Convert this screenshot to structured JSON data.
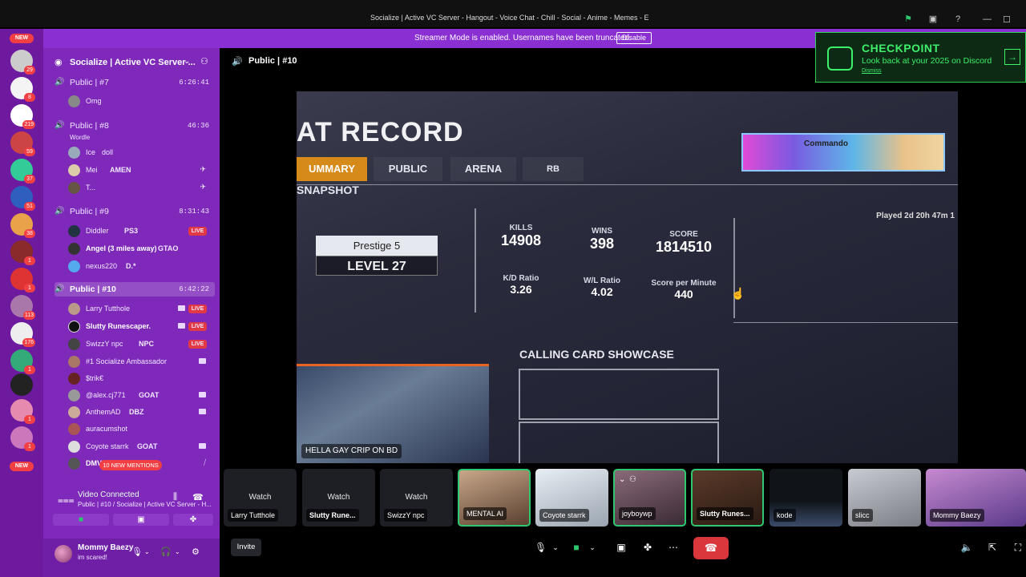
{
  "titlebar": {
    "title": "Socialize | Active VC Server - Hangout - Voice Chat - Chill - Social - Anime - Memes - E"
  },
  "banner": {
    "message": "Streamer Mode is enabled. Usernames have been truncated.",
    "disable_label": "Disable"
  },
  "rail": {
    "new_top": "NEW",
    "new_bottom": "NEW",
    "badges": [
      "29",
      "8",
      "219",
      "59",
      "37",
      "51",
      "38",
      "1",
      "1",
      "113",
      "176",
      "1",
      "1",
      "1"
    ]
  },
  "server": {
    "name": "Socialize | Active VC Server ..."
  },
  "channels": [
    {
      "name": "Public | #7",
      "time": "6:26:41"
    },
    {
      "name": "Public | #8",
      "time": "46:36",
      "activity": "Wordle"
    },
    {
      "name": "Public | #9",
      "time": "8:31:43"
    },
    {
      "name": "Public | #10",
      "time": "6:42:22"
    }
  ],
  "users": {
    "c7": [
      "Omg"
    ],
    "c8": [
      "Ice",
      "Mei",
      "T..."
    ],
    "c8_tags": [
      "doll",
      "AMEN"
    ],
    "c9": [
      "Diddler",
      "Angel (3 miles away)",
      "nexus220"
    ],
    "c9_tags": [
      "PS3",
      "GTAO",
      "D.*"
    ],
    "c10": [
      "Larry Tutthole",
      "Slutty Runescaper.",
      "SwizzY npc",
      "#1 Socialize Ambassador",
      "$trik€",
      "@alex.cj771",
      "AnthemAD",
      "auracumshot",
      "Coyote starrk",
      "DMV"
    ],
    "c10_tags": [
      "NPC",
      "GOAT",
      "DBZ",
      "GOAT"
    ]
  },
  "live_label": "LIVE",
  "mentions": "10 NEW MENTIONS",
  "voice": {
    "status": "Video Connected",
    "path": "Public | #10 / Socialize | Active VC Server - H..."
  },
  "me": {
    "name": "Mommy Baezy",
    "status": "im scared!"
  },
  "stage": {
    "title": "Public | #10",
    "caption": "HELLA GAY CRIP ON BD"
  },
  "game": {
    "title": "AT RECORD",
    "tabs": [
      "UMMARY",
      "PUBLIC",
      "ARENA",
      "RB"
    ],
    "snapshot": "SNAPSHOT",
    "prestige": "Prestige 5",
    "level": "LEVEL 27",
    "banner_name": "Commando",
    "played": "Played 2d 20h 47m 1",
    "stats": [
      {
        "k": "KILLS",
        "v": "14908"
      },
      {
        "k": "WINS",
        "v": "398"
      },
      {
        "k": "SCORE",
        "v": "1814510"
      },
      {
        "k": "K/D Ratio",
        "v": "3.26"
      },
      {
        "k": "W/L Ratio",
        "v": "4.02"
      },
      {
        "k": "Score per Minute",
        "v": "440"
      }
    ],
    "calling_card": "CALLING CARD SHOWCASE"
  },
  "checkpoint": {
    "heading": "CHECKPOINT",
    "subtitle": "Look back at your 2025 on Discord",
    "dismiss": "Dismiss"
  },
  "tiles": [
    {
      "name": "Larry Tutthole",
      "watch": "Watch"
    },
    {
      "name": "Slutty Rune...",
      "watch": "Watch"
    },
    {
      "name": "SwizzY npc",
      "watch": "Watch"
    },
    {
      "name": "MENTAL AI"
    },
    {
      "name": "Coyote starrk"
    },
    {
      "name": "joyboywp"
    },
    {
      "name": "Slutty Runes..."
    },
    {
      "name": "kode"
    },
    {
      "name": "slicc"
    },
    {
      "name": "Mommy Baezy"
    }
  ],
  "controls": {
    "invite": "Invite"
  }
}
